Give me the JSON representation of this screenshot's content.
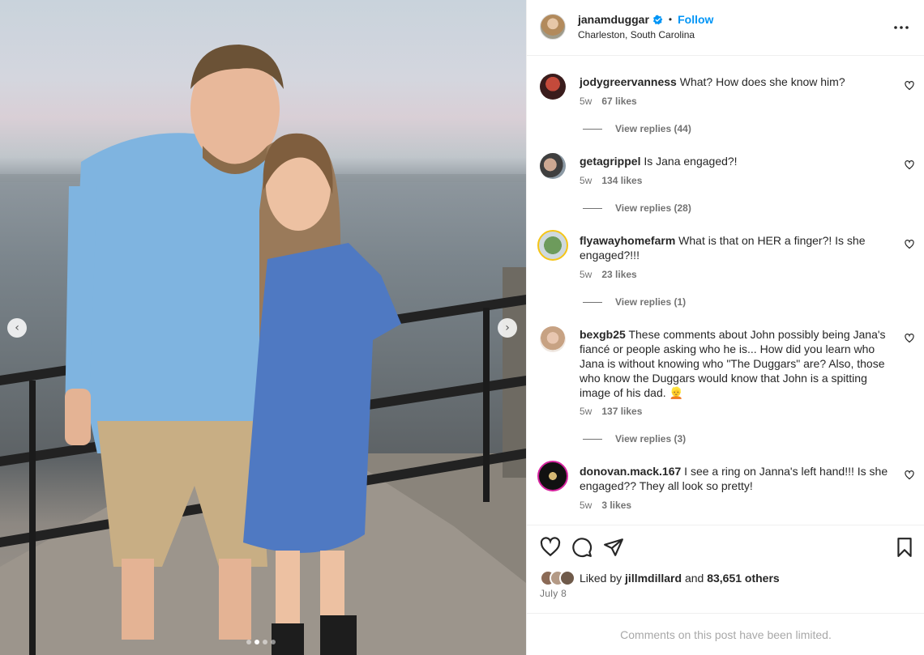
{
  "post": {
    "username": "janamduggar",
    "verified_icon": "verified-badge-icon",
    "separator": "•",
    "follow_label": "Follow",
    "location": "Charleston, South Carolina",
    "more_icon": "more-options-icon"
  },
  "photo": {
    "prev_icon": "chevron-left-icon",
    "next_icon": "chevron-right-icon",
    "prev_glyph": "‹",
    "next_glyph": "›",
    "slide_count": 4,
    "active_slide": 2
  },
  "comments": [
    {
      "username": "jodygreervanness",
      "text": "What? How does she know him?",
      "time": "5w",
      "likes": "67 likes",
      "replies": "View replies (44)"
    },
    {
      "username": "getagrippel",
      "text": "Is Jana engaged?!",
      "time": "5w",
      "likes": "134 likes",
      "replies": "View replies (28)"
    },
    {
      "username": "flyawayhomefarm",
      "text": "What is that on HER a finger?! Is she engaged?!!!",
      "time": "5w",
      "likes": "23 likes",
      "replies": "View replies (1)"
    },
    {
      "username": "bexgb25",
      "text": "These comments about John possibly being Jana's fiancé or people asking who he is... How did you learn who Jana is without knowing who \"The Duggars\" are? Also, those who know the Duggars would know that John is a spitting image of his dad. 👱",
      "time": "5w",
      "likes": "137 likes",
      "replies": "View replies (3)"
    },
    {
      "username": "donovan.mack.167",
      "text": "I see a ring on Janna's left hand!!! Is she engaged?? They all look so pretty!",
      "time": "5w",
      "likes": "3 likes",
      "replies": ""
    }
  ],
  "actions": {
    "like_icon": "heart-icon",
    "comment_icon": "comment-icon",
    "share_icon": "send-icon",
    "save_icon": "bookmark-icon"
  },
  "likes_summary": {
    "prefix": "Liked by",
    "user": "jillmdillard",
    "conjunction": "and",
    "others": "83,651 others"
  },
  "date": "July 8",
  "comments_limited": "Comments on this post have been limited.",
  "colors": {
    "link_blue": "#0095f6",
    "muted": "#737373",
    "border": "#efefef"
  }
}
